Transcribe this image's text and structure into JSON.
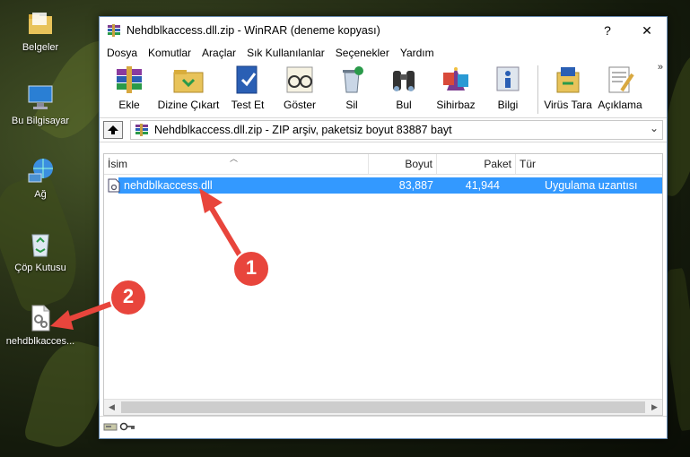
{
  "desktop": {
    "icons": [
      {
        "label": "Belgeler",
        "icon": "folder-icon"
      },
      {
        "label": "Bu Bilgisayar",
        "icon": "computer-icon"
      },
      {
        "label": "Ağ",
        "icon": "network-icon"
      },
      {
        "label": "Çöp Kutusu",
        "icon": "recycle-bin-icon"
      },
      {
        "label": "nehdblkacces...",
        "icon": "dll-file-icon"
      }
    ]
  },
  "window": {
    "title": "Nehdblkaccess.dll.zip - WinRAR (deneme kopyası)",
    "help": "?",
    "close": "✕"
  },
  "menu": [
    "Dosya",
    "Komutlar",
    "Araçlar",
    "Sık Kullanılanlar",
    "Seçenekler",
    "Yardım"
  ],
  "toolbar": [
    {
      "label": "Ekle",
      "icon": "add-books-icon"
    },
    {
      "label": "Dizine Çıkart",
      "icon": "extract-folder-icon"
    },
    {
      "label": "Test Et",
      "icon": "test-icon"
    },
    {
      "label": "Göster",
      "icon": "view-glasses-icon"
    },
    {
      "label": "Sil",
      "icon": "delete-icon"
    },
    {
      "label": "Bul",
      "icon": "find-binoculars-icon"
    },
    {
      "label": "Sihirbaz",
      "icon": "wizard-icon"
    },
    {
      "label": "Bilgi",
      "icon": "info-icon"
    },
    {
      "label": "Virüs Tara",
      "icon": "virus-scan-icon"
    },
    {
      "label": "Açıklama",
      "icon": "comment-icon"
    }
  ],
  "more": "»",
  "path": {
    "text": "Nehdblkaccess.dll.zip - ZIP arşiv, paketsiz boyut 83887 bayt",
    "dropdown": "⌄"
  },
  "columns": [
    "İsim",
    "Boyut",
    "Paket",
    "Tür"
  ],
  "files": [
    {
      "name": "nehdblkaccess.dll",
      "size": "83,887",
      "packed": "41,944",
      "type": "Uygulama uzantısı"
    }
  ],
  "annotations": [
    "1",
    "2"
  ],
  "colors": {
    "selection": "#3399ff",
    "arrow": "#e8453c"
  }
}
